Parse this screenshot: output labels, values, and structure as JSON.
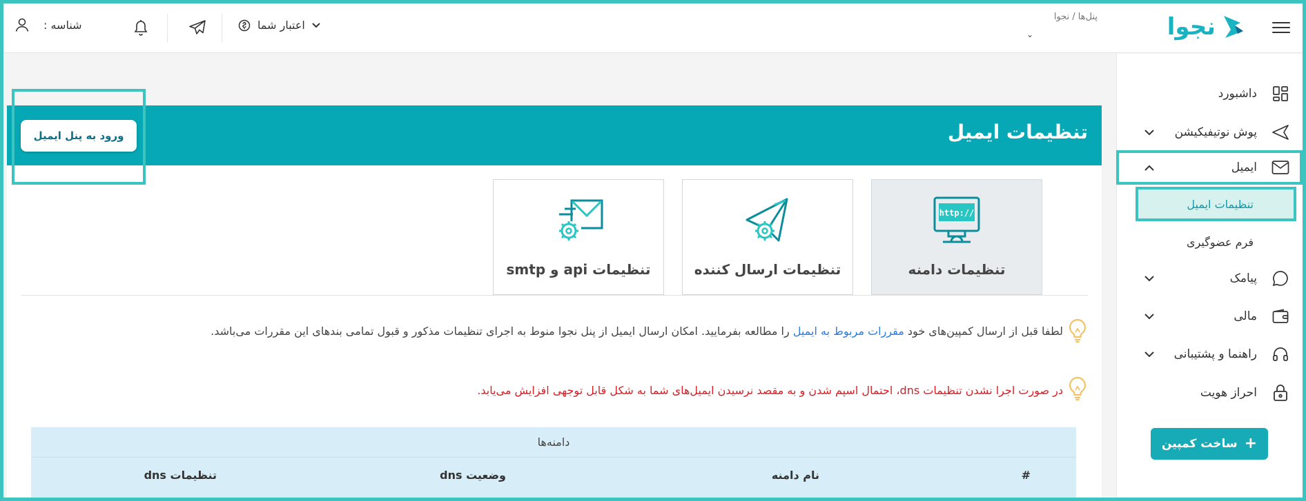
{
  "header": {
    "logo_text": "نجوا",
    "breadcrumb": "پنل‌ها / نجوا",
    "breadcrumb_arrow": "⌄",
    "credit_label": "اعتبار شما",
    "profile_label": "شناسه :"
  },
  "sidebar": {
    "items": [
      {
        "label": "داشبورد",
        "icon": "dashboard-icon"
      },
      {
        "label": "پوش نوتیفیکیشن",
        "icon": "send-icon"
      },
      {
        "label": "ایمیل",
        "icon": "mail-icon"
      },
      {
        "label": "پیامک",
        "icon": "chat-icon"
      },
      {
        "label": "مالی",
        "icon": "wallet-icon"
      },
      {
        "label": "راهنما و پشتیبانی",
        "icon": "headset-icon"
      },
      {
        "label": "احراز هویت",
        "icon": "lock-icon"
      }
    ],
    "email_sub": [
      {
        "label": "تنظیمات ایمیل",
        "selected": true
      },
      {
        "label": "فرم عضوگیری",
        "selected": false
      }
    ],
    "campaign_button": "ساخت کمپین"
  },
  "main": {
    "title": "تنظیمات ایمیل",
    "login_button": "ورود به پنل ایمیل",
    "tiles": [
      {
        "label": "تنظیمات دامنه",
        "icon": "domain-http-icon",
        "selected": true
      },
      {
        "label": "تنظیمات ارسال کننده",
        "icon": "sender-settings-icon",
        "selected": false
      },
      {
        "label": "تنظیمات api و smtp",
        "icon": "smtp-settings-icon",
        "selected": false
      }
    ],
    "note1_before": "لطفا قبل از ارسال کمپین‌های خود ",
    "note1_link": "مقررات مربوط به ایمیل",
    "note1_after": " را مطالعه بفرمایید. امکان ارسال ایمیل از پنل نجوا منوط به اجرای تنظیمات مذکور و قبول تمامی بندهای این مقررات می‌باشد.",
    "note2": "در صورت اجرا نشدن تنظیمات dns، احتمال اسپم شدن و به مقصد نرسیدن ایمیل‌های شما به شکل قابل توجهی افزایش می‌یابد.",
    "table": {
      "caption": "دامنه‌ها",
      "headers": [
        "#",
        "نام دامنه",
        "وضعیت dns",
        "تنظیمات dns"
      ]
    }
  },
  "colors": {
    "accent": "#06a8b6",
    "highlight": "#3cc4c0",
    "warning": "#d81f26",
    "link": "#2b7be0"
  }
}
